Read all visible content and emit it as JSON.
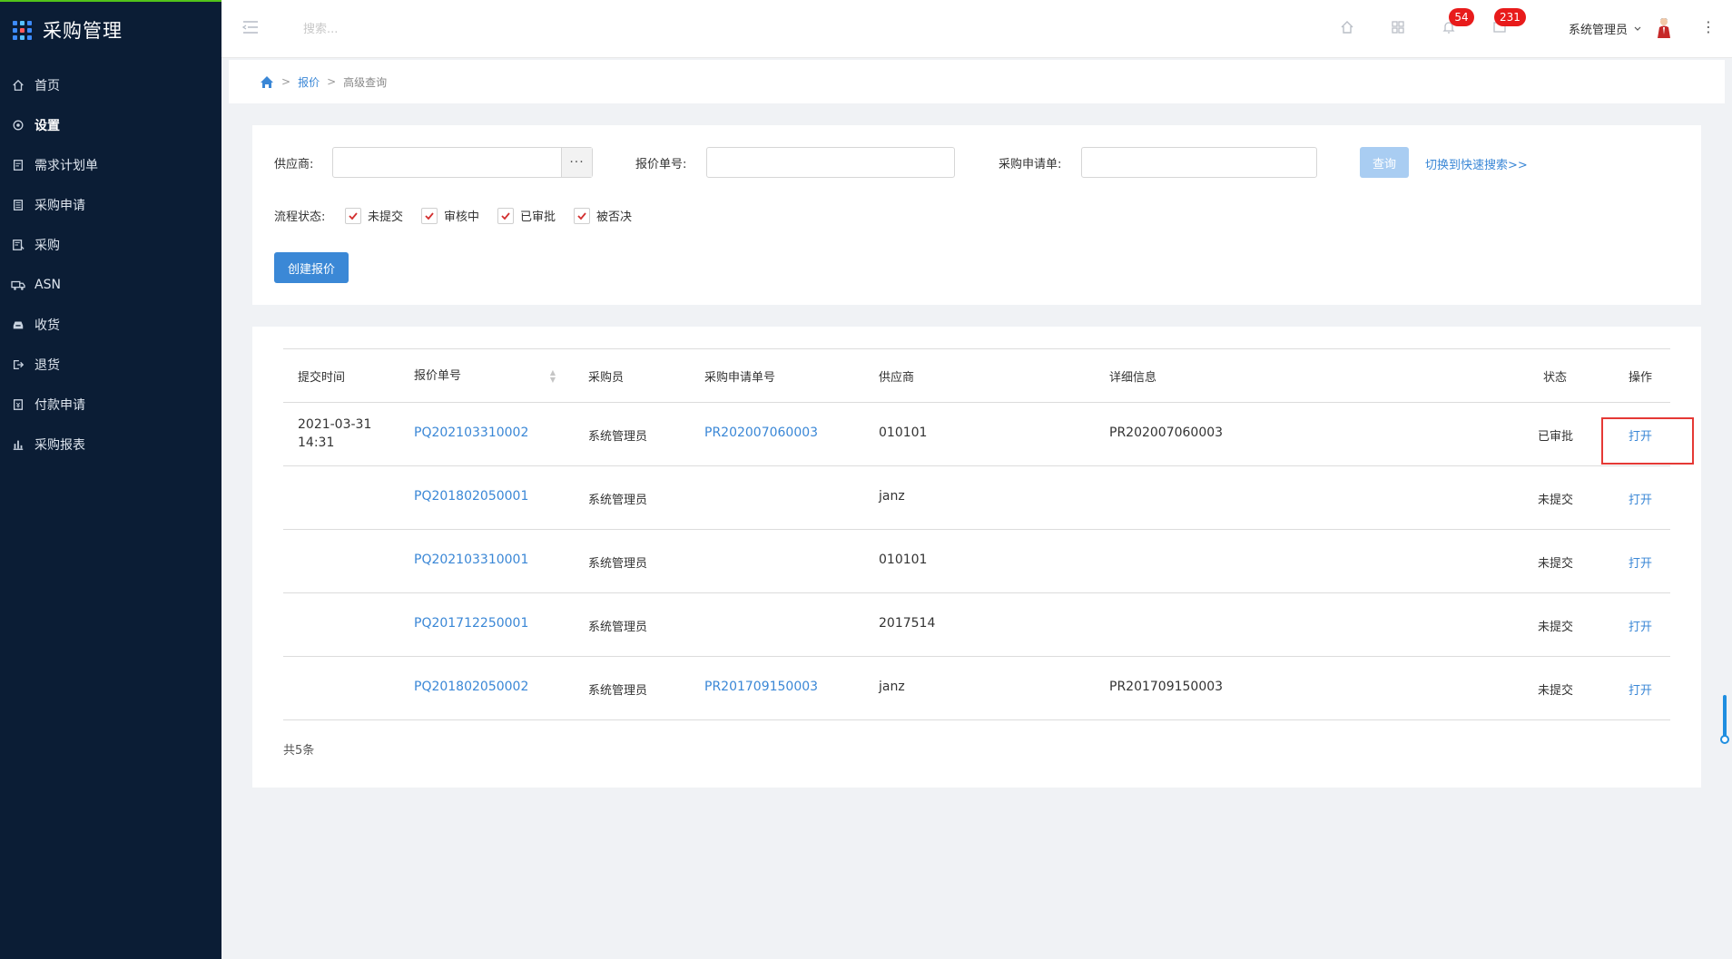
{
  "app": {
    "title": "采购管理"
  },
  "sidebar": {
    "items": [
      {
        "label": "首页",
        "icon": "home-icon"
      },
      {
        "label": "设置",
        "icon": "gear-icon",
        "active": true
      },
      {
        "label": "需求计划单",
        "icon": "doc-icon"
      },
      {
        "label": "采购申请",
        "icon": "form-icon"
      },
      {
        "label": "采购",
        "icon": "order-icon"
      },
      {
        "label": "ASN",
        "icon": "truck-icon"
      },
      {
        "label": "收货",
        "icon": "inbox-icon"
      },
      {
        "label": "退货",
        "icon": "return-icon"
      },
      {
        "label": "付款申请",
        "icon": "payment-icon"
      },
      {
        "label": "采购报表",
        "icon": "chart-icon"
      }
    ]
  },
  "header": {
    "search_placeholder": "搜索...",
    "notifications_count": "54",
    "messages_count": "231",
    "user_name": "系统管理员"
  },
  "breadcrumb": {
    "level1": "报价",
    "level2": "高级查询",
    "separator": ">"
  },
  "filters": {
    "supplier_label": "供应商:",
    "quote_no_label": "报价单号:",
    "purchase_request_label": "采购申请单:",
    "query_button": "查询",
    "switch_link": "切换到快速搜索>>",
    "status_label": "流程状态:",
    "statuses": [
      {
        "label": "未提交",
        "checked": true
      },
      {
        "label": "审核中",
        "checked": true
      },
      {
        "label": "已审批",
        "checked": true
      },
      {
        "label": "被否决",
        "checked": true
      }
    ],
    "create_button": "创建报价"
  },
  "table": {
    "columns": [
      "提交时间",
      "报价单号",
      "采购员",
      "采购申请单号",
      "供应商",
      "详细信息",
      "状态",
      "操作"
    ],
    "rows": [
      {
        "submit_date": "2021-03-31",
        "submit_time": "14:31",
        "quote_no": "PQ202103310002",
        "buyer": "系统管理员",
        "pr_no": "PR202007060003",
        "supplier": "010101",
        "detail": "PR202007060003",
        "status": "已审批",
        "action": "打开"
      },
      {
        "submit_date": "",
        "submit_time": "",
        "quote_no": "PQ201802050001",
        "buyer": "系统管理员",
        "pr_no": "",
        "supplier": "janz",
        "detail": "",
        "status": "未提交",
        "action": "打开"
      },
      {
        "submit_date": "",
        "submit_time": "",
        "quote_no": "PQ202103310001",
        "buyer": "系统管理员",
        "pr_no": "",
        "supplier": "010101",
        "detail": "",
        "status": "未提交",
        "action": "打开"
      },
      {
        "submit_date": "",
        "submit_time": "",
        "quote_no": "PQ201712250001",
        "buyer": "系统管理员",
        "pr_no": "",
        "supplier": "2017514",
        "detail": "",
        "status": "未提交",
        "action": "打开"
      },
      {
        "submit_date": "",
        "submit_time": "",
        "quote_no": "PQ201802050002",
        "buyer": "系统管理员",
        "pr_no": "PR201709150003",
        "supplier": "janz",
        "detail": "PR201709150003",
        "status": "未提交",
        "action": "打开"
      }
    ],
    "total": "共5条"
  },
  "colors": {
    "sidebar_bg": "#0b1d35",
    "link": "#3a87d6",
    "primary_button": "#3b88d6",
    "badge": "#e81b1b",
    "highlight": "#e53935"
  }
}
